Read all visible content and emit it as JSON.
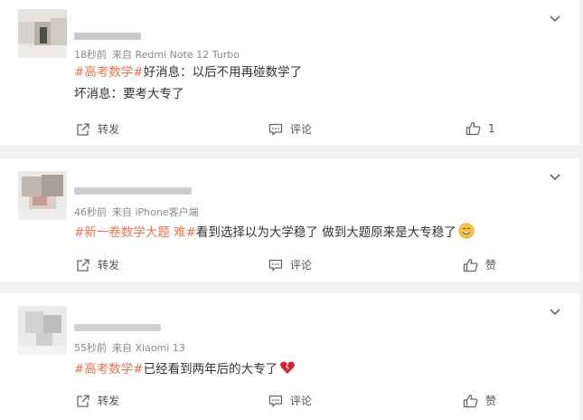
{
  "colors": {
    "topic": "#eb7350",
    "text": "#333333",
    "meta": "#8a8a8a",
    "background": "#f2f2f2"
  },
  "posts": [
    {
      "time": "18秒前",
      "source": "来自 Redmi Note 12 Turbo",
      "topic": "#高考数学#",
      "text": "好消息：以后不用再碰数学了",
      "line2": "坏消息：要考大专了",
      "repost_label": "转发",
      "comment_label": "评论",
      "like_label": "1",
      "icons": [
        "chevron-down-icon",
        "repost-icon",
        "comment-icon",
        "like-icon"
      ]
    },
    {
      "time": "46秒前",
      "source": "来自 iPhone客户端",
      "topic": "#新一卷数学大题 难#",
      "text": "看到选择以为大学稳了 做到大题原来是大专稳了",
      "repost_label": "转发",
      "comment_label": "评论",
      "like_label": "赞",
      "icons": [
        "chevron-down-icon",
        "smile-emoji-icon",
        "repost-icon",
        "comment-icon",
        "like-icon"
      ]
    },
    {
      "time": "55秒前",
      "source": "来自 Xiaomi 13",
      "topic": "#高考数学#",
      "text": "已经看到两年后的大专了",
      "repost_label": "转发",
      "comment_label": "评论",
      "like_label": "赞",
      "icons": [
        "chevron-down-icon",
        "broken-heart-icon",
        "repost-icon",
        "comment-icon",
        "like-icon"
      ]
    }
  ]
}
